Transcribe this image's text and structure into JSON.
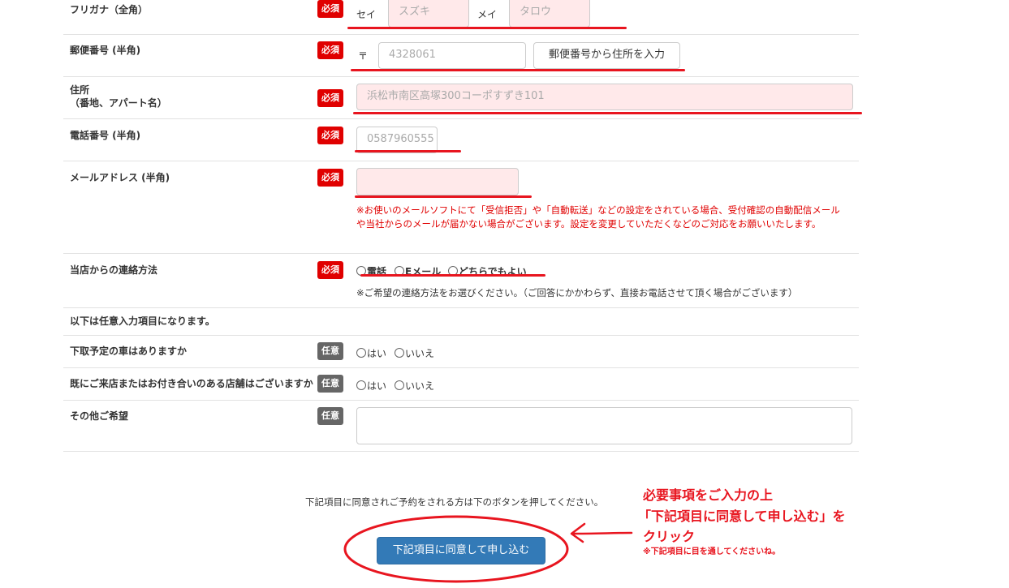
{
  "badges": {
    "required": "必須",
    "optional": "任意"
  },
  "furigana": {
    "label": "フリガナ（全角）",
    "sei_label": "セイ",
    "sei_placeholder": "スズキ",
    "mei_label": "メイ",
    "mei_placeholder": "タロウ"
  },
  "postal": {
    "label": "郵便番号 (半角)",
    "mark": "〒",
    "placeholder": "4328061",
    "lookup_button": "郵便番号から住所を入力"
  },
  "address": {
    "label_line1": "住所",
    "label_line2": "（番地、アパート名）",
    "placeholder": "浜松市南区高塚300コーポすずき101"
  },
  "phone": {
    "label": "電話番号 (半角)",
    "placeholder": "0587960555"
  },
  "email": {
    "label": "メールアドレス (半角)",
    "value": "",
    "notice": "※お使いのメールソフトにて「受信拒否」や「自動転送」などの設定をされている場合、受付確認の自動配信メールや当社からのメールが届かない場合がございます。設定を変更していただくなどのご対応をお願いいたします。"
  },
  "contact": {
    "label": "当店からの連絡方法",
    "options": [
      "電話",
      "Eメール",
      "どちらでもよい"
    ],
    "note": "※ご希望の連絡方法をお選びください。（ご回答にかかわらず、直接お電話させて頂く場合がございます）"
  },
  "optional_header": "以下は任意入力項目になります。",
  "trade_in": {
    "label": "下取予定の車はありますか",
    "yes": "はい",
    "no": "いいえ"
  },
  "visited": {
    "label": "既にご来店またはお付き合いのある店舗はございますか",
    "yes": "はい",
    "no": "いいえ"
  },
  "other": {
    "label": "その他ご希望",
    "value": ""
  },
  "submit": {
    "note": "下記項目に同意されご予約をされる方は下のボタンを押してください。",
    "button": "下記項目に同意して申し込む"
  },
  "annotation": {
    "line1": "必要事項をご入力の上",
    "line2": "「下記項目に同意して申し込む」を",
    "line3": "クリック",
    "sub": "※下記項目に目を通してくださいね。"
  },
  "colors": {
    "required_badge": "#e00000",
    "optional_badge": "#666666",
    "input_bg": "#ffe9ea",
    "submit_btn": "#337ab7",
    "annotation_red": "#e8151f"
  }
}
